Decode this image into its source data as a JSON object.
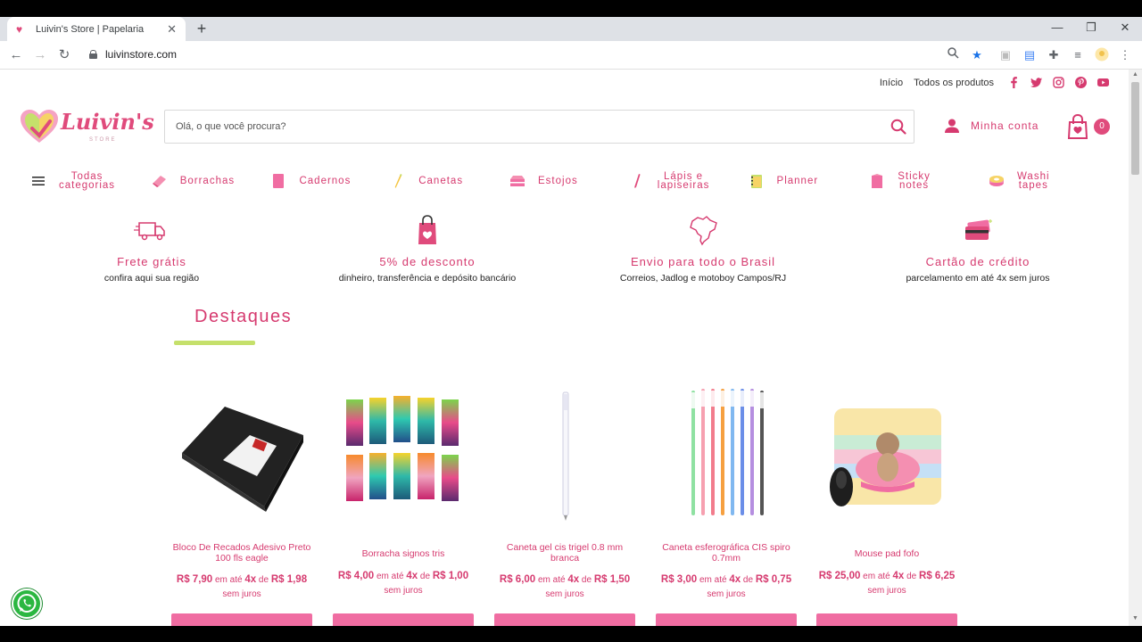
{
  "browser": {
    "tab_title": "Luivin's Store | Papelaria",
    "tab_close": "✕",
    "new_tab": "+",
    "url": "luivinstore.com"
  },
  "header": {
    "top_links": [
      "Início",
      "Todos os produtos"
    ],
    "social": [
      "facebook-icon",
      "twitter-icon",
      "instagram-icon",
      "pinterest-icon",
      "youtube-icon"
    ],
    "logo_text": "Luivin's",
    "logo_sub": "STORE",
    "search_placeholder": "Olá, o que você procura?",
    "account_label": "Minha conta",
    "cart_count": "0"
  },
  "categories": [
    {
      "label": "Todas\ncategorias",
      "icon": "menu-icon"
    },
    {
      "label": "Borrachas",
      "icon": "eraser-icon"
    },
    {
      "label": "Cadernos",
      "icon": "notebook-icon"
    },
    {
      "label": "Canetas",
      "icon": "pen-icon"
    },
    {
      "label": "Estojos",
      "icon": "pencil-case-icon"
    },
    {
      "label": "Lápis e\nlapiseiras",
      "icon": "pencil-icon"
    },
    {
      "label": "Planner",
      "icon": "planner-icon"
    },
    {
      "label": "Sticky\nnotes",
      "icon": "sticky-notes-icon"
    },
    {
      "label": "Washi\ntapes",
      "icon": "washi-tape-icon"
    }
  ],
  "benefits": [
    {
      "title": "Frete grátis",
      "desc": "confira aqui sua região",
      "icon": "truck-icon"
    },
    {
      "title": "5% de desconto",
      "desc": "dinheiro, transferência e depósito bancário",
      "icon": "shopping-bag-icon"
    },
    {
      "title": "Envio para todo o Brasil",
      "desc": "Correios, Jadlog e motoboy Campos/RJ",
      "icon": "brazil-map-icon"
    },
    {
      "title": "Cartão de crédito",
      "desc": "parcelamento em até 4x sem juros",
      "icon": "credit-card-icon"
    }
  ],
  "section_title": "Destaques",
  "products": [
    {
      "name": "Bloco De Recados Adesivo Preto 100 fls eagle",
      "price": "R$ 7,90",
      "inst_text": "em até",
      "inst_n": "4x",
      "inst_de": "de",
      "inst_value": "R$ 1,98",
      "no_interest": "sem juros"
    },
    {
      "name": "Borracha signos tris",
      "price": "R$ 4,00",
      "inst_text": "em até",
      "inst_n": "4x",
      "inst_de": "de",
      "inst_value": "R$ 1,00",
      "no_interest": "sem juros"
    },
    {
      "name": "Caneta gel cis trigel 0.8 mm branca",
      "price": "R$ 6,00",
      "inst_text": "em até",
      "inst_n": "4x",
      "inst_de": "de",
      "inst_value": "R$ 1,50",
      "no_interest": "sem juros"
    },
    {
      "name": "Caneta esferográfica CIS spiro 0.7mm",
      "price": "R$ 3,00",
      "inst_text": "em até",
      "inst_n": "4x",
      "inst_de": "de",
      "inst_value": "R$ 0,75",
      "no_interest": "sem juros"
    },
    {
      "name": "Mouse pad fofo",
      "price": "R$ 25,00",
      "inst_text": "em até",
      "inst_n": "4x",
      "inst_de": "de",
      "inst_value": "R$ 6,25",
      "no_interest": "sem juros"
    }
  ],
  "colors": {
    "brand": "#d63a6f",
    "accent": "#c5e06b",
    "button": "#f06da2"
  }
}
